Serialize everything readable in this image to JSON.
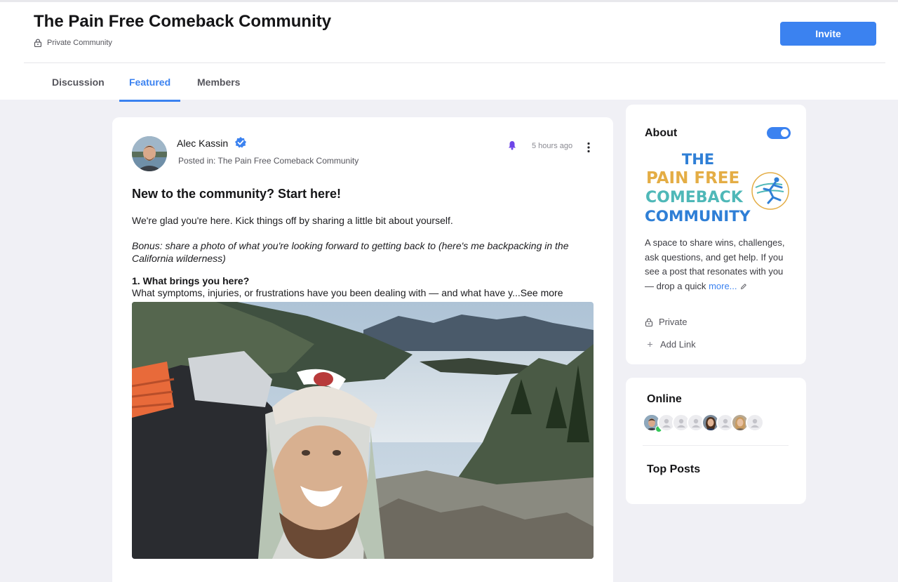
{
  "header": {
    "title": "The Pain Free Comeback Community",
    "privacy_label": "Private Community",
    "invite_label": "Invite",
    "tabs": [
      {
        "label": "Discussion"
      },
      {
        "label": "Featured",
        "active": true
      },
      {
        "label": "Members"
      }
    ]
  },
  "post": {
    "author": "Alec Kassin",
    "posted_in": "Posted in: The Pain Free Comeback Community",
    "time": "5 hours ago",
    "title": "New to the community? Start here!",
    "intro": "We're glad you're here. Kick things off by sharing a little bit about yourself.",
    "bonus": "Bonus: share a photo of what you're looking forward to getting back to (here's me backpacking in the California wilderness)",
    "question_title": "1. What brings you here?",
    "question_text": "What symptoms, injuries, or frustrations have you been dealing with — and what have y...",
    "see_more": "See more"
  },
  "about": {
    "heading": "About",
    "toggle_on": true,
    "logo_lines": [
      "THE",
      "PAIN FREE",
      "COMEBACK",
      "COMMUNITY"
    ],
    "description": "A space to share wins, challenges, ask questions, and get help. If you see a post that resonates with you — drop a quick",
    "more_label": "more...",
    "privacy": "Private",
    "add_link": "Add Link"
  },
  "online": {
    "heading": "Online",
    "top_posts": "Top Posts"
  },
  "colors": {
    "accent": "#3b82f0",
    "online_green": "#34c759",
    "logo_blue": "#2f7fd6",
    "logo_gold": "#e4ad45",
    "logo_teal": "#4fb8b8",
    "bell_purple": "#6d44e8"
  },
  "icons": [
    "lock-icon",
    "verified-badge-icon",
    "bell-icon",
    "more-vertical-icon",
    "pencil-icon",
    "plus-icon",
    "runner-icon"
  ]
}
